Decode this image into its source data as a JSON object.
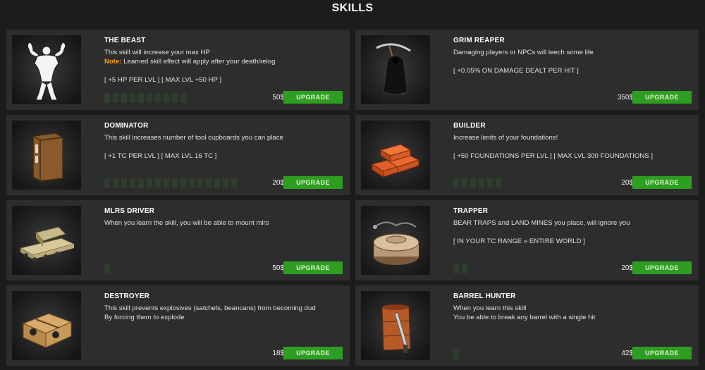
{
  "title": "SKILLS",
  "skills": [
    {
      "name": "THE BEAST",
      "icon": "bodybuilder-icon",
      "lines": [
        "This skill will increase your max HP"
      ],
      "note_label": "Note:",
      "note_text": " Learned skill effect will apply after your death/relog",
      "stats": "[ +5 HP PER LVL ] [ MAX LVL +50 HP ]",
      "max_level": 10,
      "price": "50$",
      "button": "UPGRADE"
    },
    {
      "name": "GRIM REAPER",
      "icon": "reaper-icon",
      "lines": [
        "Damaging players or NPCs will leech some life"
      ],
      "note_label": "",
      "note_text": "",
      "stats": "[ +0.05% ON DAMAGE DEALT PER HIT ]",
      "max_level": 0,
      "price": "350$",
      "button": "UPGRADE"
    },
    {
      "name": "DOMINATOR",
      "icon": "tool-cupboard-icon",
      "lines": [
        "This skill increases number of tool cupboards you can place"
      ],
      "note_label": "",
      "note_text": "",
      "stats": "[ +1 TC PER LVL ] [ MAX LVL 16 TC ]",
      "max_level": 16,
      "price": "20$",
      "button": "UPGRADE"
    },
    {
      "name": "BUILDER",
      "icon": "bricks-icon",
      "lines": [
        "Increase limits of your foundations!"
      ],
      "note_label": "",
      "note_text": "",
      "stats": "[ +50 FOUNDATIONS PER LVL ] [ MAX LVL 300 FOUNDATIONS ]",
      "max_level": 6,
      "price": "20$",
      "button": "UPGRADE"
    },
    {
      "name": "MLRS DRIVER",
      "icon": "mlrs-icon",
      "lines": [
        "When you learn the skill, you will be able to mount mlrs"
      ],
      "note_label": "",
      "note_text": "",
      "stats": "",
      "max_level": 1,
      "price": "50$",
      "button": "UPGRADE"
    },
    {
      "name": "TRAPPER",
      "icon": "landmine-icon",
      "lines": [
        "BEAR TRAPS and LAND MINES you place, will ignore you"
      ],
      "note_label": "",
      "note_text": "",
      "stats": "[ IN YOUR TC RANGE » ENTIRE WORLD ]",
      "max_level": 2,
      "price": "20$",
      "button": "UPGRADE"
    },
    {
      "name": "DESTROYER",
      "icon": "satchel-icon",
      "lines": [
        "This skill prevents explosives (satchels, beancans) from becoming dud",
        "By forcing them to explode"
      ],
      "note_label": "",
      "note_text": "",
      "stats": "",
      "max_level": 1,
      "price": "18$",
      "button": "UPGRADE"
    },
    {
      "name": "BARREL HUNTER",
      "icon": "barrel-knife-icon",
      "lines": [
        "When you learn this skill",
        "You be able to break any barrel with a single hit"
      ],
      "note_label": "",
      "note_text": "",
      "stats": "",
      "max_level": 1,
      "price": "42$",
      "button": "UPGRADE"
    }
  ],
  "colors": {
    "upgrade_button": "#2e9e22",
    "note_label": "#f0a020",
    "card_bg": "#2d2d2d",
    "page_bg": "#1c1c1c"
  }
}
